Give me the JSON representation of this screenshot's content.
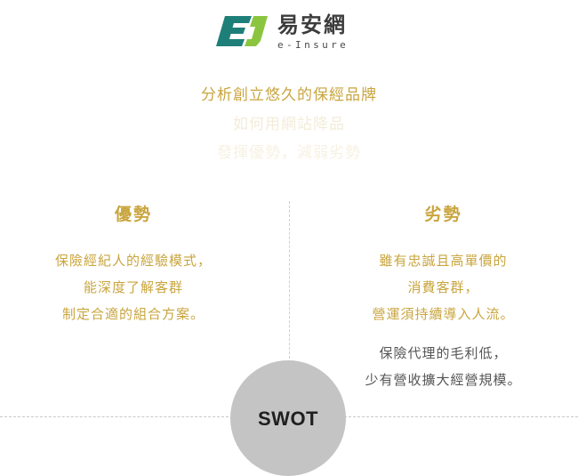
{
  "brand": {
    "name": "易安網",
    "sub": "e-Insure",
    "mark_text": "EJ",
    "colors": {
      "mark_teal": "#1e7f79",
      "mark_green": "#8bc53f",
      "gold": "#c9a53e",
      "gray": "#555555",
      "swot_circle": "#c4c4c4"
    }
  },
  "headline": {
    "line1": "分析創立悠久的保經品牌",
    "line2": "如何用網站降品",
    "line3": "發揮優勢，減弱劣勢"
  },
  "strengths": {
    "title": "優勢",
    "lines": [
      "保險經紀人的經驗模式，",
      "能深度了解客群",
      "制定合適的組合方案。"
    ]
  },
  "weaknesses": {
    "title": "劣勢",
    "lines": [
      "雖有忠誠且高單價的",
      "消費客群，",
      "營運須持續導入人流。"
    ],
    "extra_lines": [
      "保險代理的毛利低，",
      "少有營收擴大經營規模。"
    ]
  },
  "swot": {
    "label": "SWOT"
  }
}
